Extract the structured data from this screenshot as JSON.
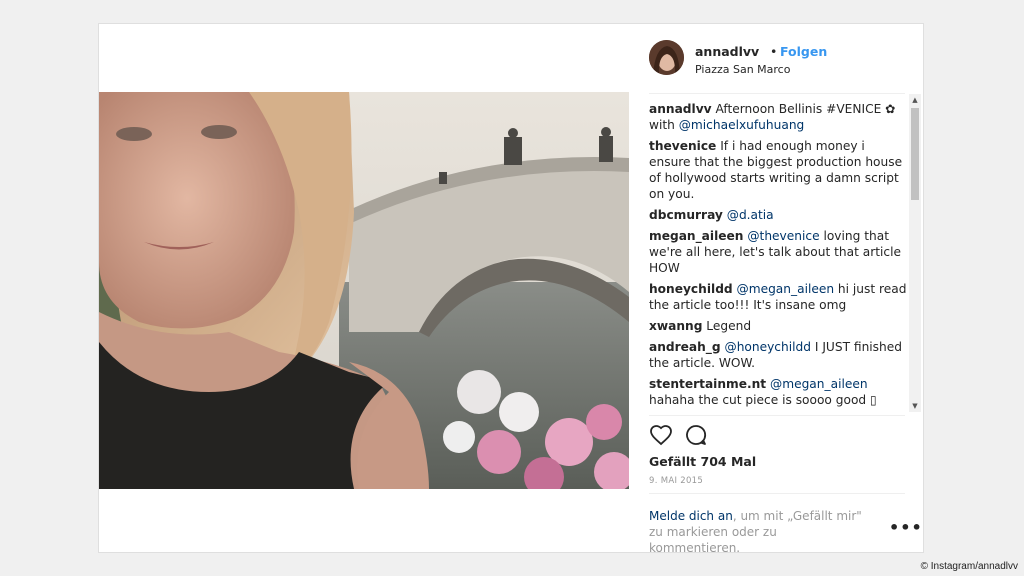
{
  "post": {
    "username": "annadlvv",
    "separator": "•",
    "follow_label": "Folgen",
    "location": "Piazza San Marco"
  },
  "comments": [
    {
      "user": "annadlvv",
      "text_pre": "Afternoon Bellinis #VENICE ✿ with ",
      "mention": "@michaelxufuhuang",
      "text_post": ""
    },
    {
      "user": "thevenice",
      "text_pre": "If i had enough money i ensure that the biggest production house of hollywood starts writing a damn script on you.",
      "mention": "",
      "text_post": ""
    },
    {
      "user": "dbcmurray",
      "text_pre": "",
      "mention": "@d.atia",
      "text_post": ""
    },
    {
      "user": "megan_aileen",
      "text_pre": "",
      "mention": "@thevenice",
      "text_post": " loving that we're all here, let's talk about that article HOW"
    },
    {
      "user": "honeychildd",
      "text_pre": "",
      "mention": "@megan_aileen",
      "text_post": " hi just read the article too!!! It's insane omg"
    },
    {
      "user": "xwanng",
      "text_pre": "Legend",
      "mention": "",
      "text_post": ""
    },
    {
      "user": "andreah_g",
      "text_pre": "",
      "mention": "@honeychildd",
      "text_post": " I JUST finished the article. WOW."
    },
    {
      "user": "stentertainme.nt",
      "text_pre": "",
      "mention": "@megan_aileen",
      "text_post": " hahaha the cut piece is soooo good ▯"
    }
  ],
  "actions": {
    "like_icon": "heart-icon",
    "comment_icon": "comment-bubble-icon"
  },
  "likes_text": "Gefällt 704 Mal",
  "date_text": "9. MAI 2015",
  "login": {
    "link": "Melde dich an",
    "rest": ", um mit „Gefällt mir\" zu markieren oder zu kommentieren."
  },
  "more_label": "•••",
  "credit": "© Instagram/annadlvv",
  "colors": {
    "link_blue": "#3897f0",
    "mention_blue": "#003569",
    "muted": "#999999"
  }
}
